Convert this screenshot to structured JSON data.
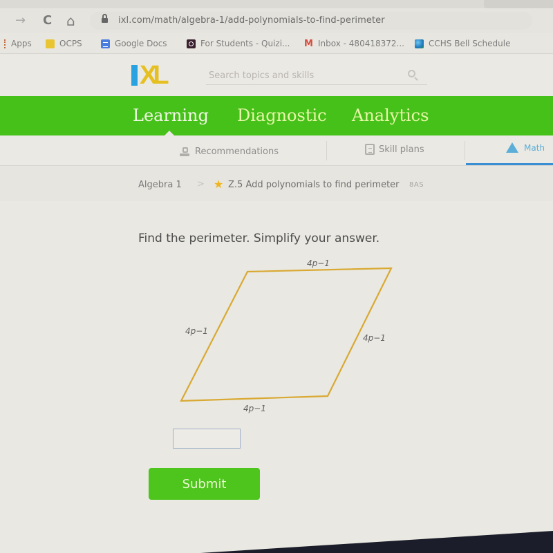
{
  "browser": {
    "url": "ixl.com/math/algebra-1/add-polynomials-to-find-perimeter",
    "nav_icons": [
      "forward-arrow-icon",
      "reload-icon",
      "home-icon",
      "lock-icon"
    ],
    "nav_glyphs": {
      "forward": "→",
      "reload": "C",
      "home": "⌂"
    },
    "bookmarks": [
      {
        "label": "Apps",
        "icon": "apps-grid-icon"
      },
      {
        "label": "OCPS",
        "icon": "folder-icon"
      },
      {
        "label": "Google Docs",
        "icon": "google-docs-icon"
      },
      {
        "label": "For Students - Quizi...",
        "icon": "quizizz-icon"
      },
      {
        "label": "Inbox - 480418372...",
        "icon": "gmail-icon"
      },
      {
        "label": "CCHS Bell Schedule",
        "icon": "globe-icon"
      }
    ]
  },
  "header": {
    "logo_i": "I",
    "logo_xl": "XL",
    "search_placeholder": "Search topics and skills"
  },
  "main_nav": {
    "tabs": [
      {
        "label": "Learning",
        "active": true
      },
      {
        "label": "Diagnostic",
        "active": false
      },
      {
        "label": "Analytics",
        "active": false
      }
    ]
  },
  "sub_nav": {
    "items": [
      {
        "label": "Recommendations",
        "icon": "recommendations-icon",
        "active": false
      },
      {
        "label": "Skill plans",
        "icon": "skill-plans-icon",
        "active": false
      },
      {
        "label": "Math",
        "icon": "math-pyramid-icon",
        "active": true
      }
    ]
  },
  "breadcrumb": {
    "subject": "Algebra 1",
    "separator": ">",
    "skill": "Z.5 Add polynomials to find perimeter",
    "skill_code": "8AS"
  },
  "question": {
    "prompt": "Find the perimeter. Simplify your answer.",
    "shape": "parallelogram",
    "side_labels": {
      "top": "4p−1",
      "left": "4p−1",
      "right": "4p−1",
      "bottom": "4p−1"
    },
    "answer_value": "",
    "submit_label": "Submit"
  },
  "colors": {
    "green_nav": "#46c11a",
    "submit_green": "#4dc51d",
    "shape_stroke": "#d9a932",
    "logo_blue": "#28a3df",
    "logo_yellow": "#e6c020",
    "active_underline": "#3a8ed4"
  }
}
